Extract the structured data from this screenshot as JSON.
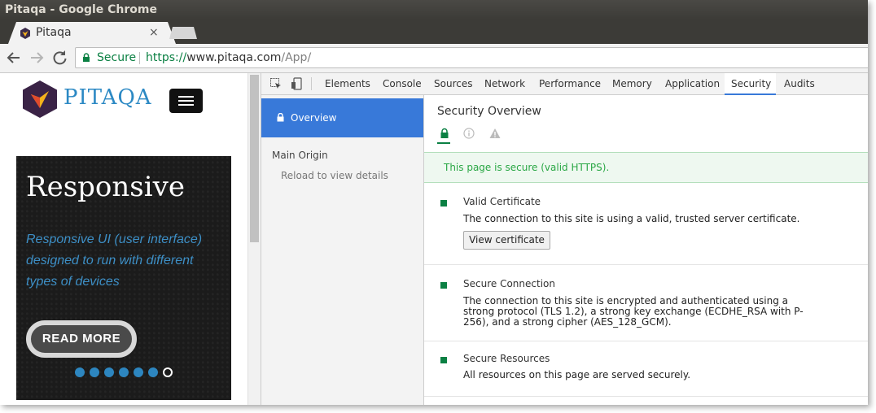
{
  "window": {
    "title": "Pitaqa - Google Chrome"
  },
  "tabs": [
    {
      "title": "Pitaqa",
      "close": "×"
    }
  ],
  "toolbar": {
    "secure_label": "Secure",
    "url_scheme": "https://",
    "url_host": "www.pitaqa.com",
    "url_path": "/App/"
  },
  "page": {
    "logo_text": "PITAQA",
    "slide": {
      "title": "Responsive",
      "text": "Responsive UI (user interface) designed to run with different types of devices",
      "button": "READ MORE",
      "dots_count": 7,
      "active_dot": 7
    }
  },
  "devtools": {
    "tabs": [
      "Elements",
      "Console",
      "Sources",
      "Network",
      "Performance",
      "Memory",
      "Application",
      "Security",
      "Audits"
    ],
    "active_tab": "Security",
    "sidebar": {
      "overview": "Overview",
      "main_origin": "Main Origin",
      "reload_hint": "Reload to view details"
    },
    "main": {
      "title": "Security Overview",
      "banner": "This page is secure (valid HTTPS).",
      "sections": [
        {
          "heading": "Valid Certificate",
          "description": "The connection to this site is using a valid, trusted server certificate.",
          "button": "View certificate"
        },
        {
          "heading": "Secure Connection",
          "description": "The connection to this site is encrypted and authenticated using a strong protocol (TLS 1.2), a strong key exchange (ECDHE_RSA with P-256), and a strong cipher (AES_128_GCM)."
        },
        {
          "heading": "Secure Resources",
          "description": "All resources on this page are served securely."
        }
      ]
    }
  },
  "colors": {
    "secure_green": "#0b8043",
    "devtools_accent": "#3879d9",
    "banner_text": "#2aa745",
    "logo_blue": "#2c89c4"
  }
}
